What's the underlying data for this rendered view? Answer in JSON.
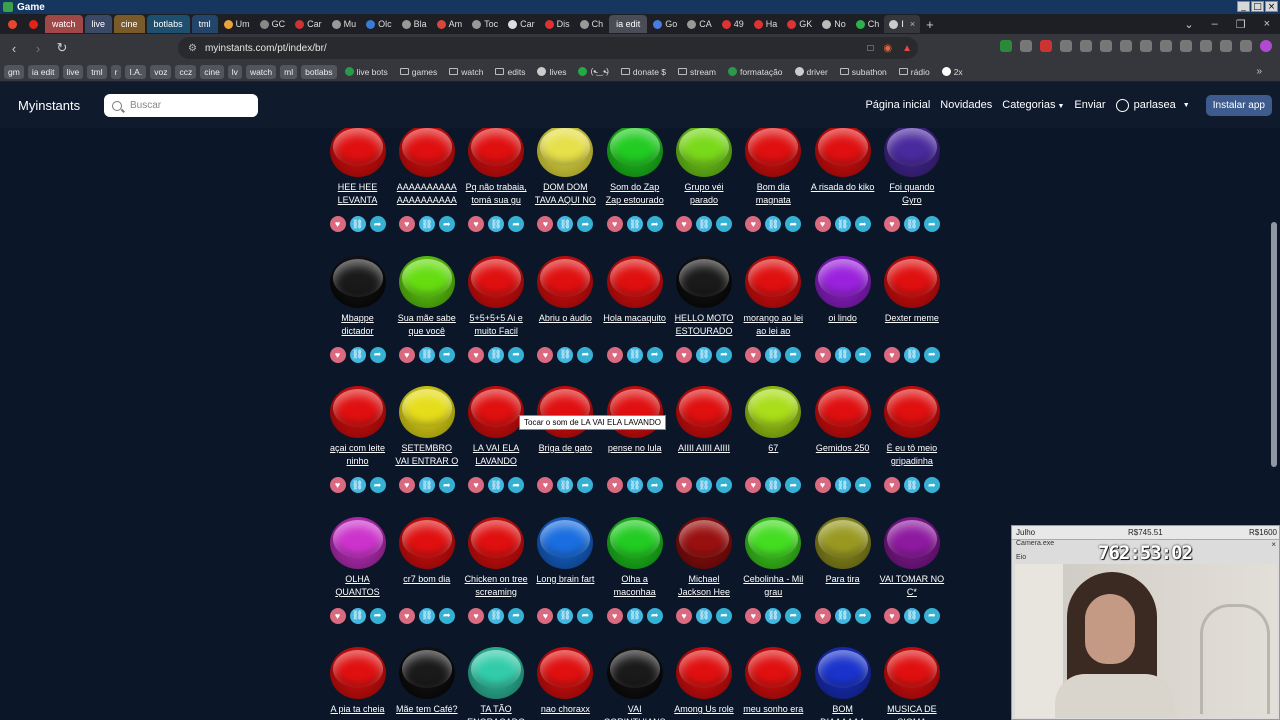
{
  "window": {
    "title": "Game"
  },
  "tabs": [
    {
      "label": "",
      "kind": "pinned",
      "color": "#e6462e"
    },
    {
      "label": "",
      "kind": "pinned",
      "color": "#e62117"
    },
    {
      "label": "watch",
      "kind": "group",
      "color": "#a04848"
    },
    {
      "label": "live",
      "kind": "group",
      "color": "#3a4a66"
    },
    {
      "label": "cine",
      "kind": "group",
      "color": "#7a5a2a"
    },
    {
      "label": "botlabs",
      "kind": "group",
      "color": "#1f4f6e"
    },
    {
      "label": "tml",
      "kind": "group",
      "color": "#24456a"
    },
    {
      "label": "Um",
      "kind": "tab",
      "color": "#e8a33c"
    },
    {
      "label": "GC",
      "kind": "tab",
      "color": "#888"
    },
    {
      "label": "Car",
      "kind": "tab",
      "color": "#c33"
    },
    {
      "label": "Mu",
      "kind": "tab",
      "color": "#999"
    },
    {
      "label": "Olc",
      "kind": "tab",
      "color": "#3a7bd5"
    },
    {
      "label": "Bla",
      "kind": "tab",
      "color": "#999"
    },
    {
      "label": "Am",
      "kind": "tab",
      "color": "#d9463b"
    },
    {
      "label": "Toc",
      "kind": "tab",
      "color": "#999"
    },
    {
      "label": "Car",
      "kind": "tab",
      "color": "#ddd"
    },
    {
      "label": "Dis",
      "kind": "tab",
      "color": "#d33"
    },
    {
      "label": "Ch",
      "kind": "tab",
      "color": "#999"
    },
    {
      "label": "ia edit",
      "kind": "group",
      "color": "#4a4d55"
    },
    {
      "label": "Go",
      "kind": "tab",
      "color": "#4a7be0"
    },
    {
      "label": "CA",
      "kind": "tab",
      "color": "#999"
    },
    {
      "label": "49",
      "kind": "tab",
      "color": "#d33"
    },
    {
      "label": "Ha",
      "kind": "tab",
      "color": "#d33"
    },
    {
      "label": "GK",
      "kind": "tab",
      "color": "#d33"
    },
    {
      "label": "No",
      "kind": "tab",
      "color": "#bbb"
    },
    {
      "label": "Ch",
      "kind": "tab",
      "color": "#2bb24c"
    },
    {
      "label": "I",
      "kind": "active",
      "color": "#ccc"
    }
  ],
  "address_bar": {
    "url": "myinstants.com/pt/index/br/"
  },
  "bookmarks": [
    {
      "label": "gm",
      "kind": "chip"
    },
    {
      "label": "ia edit",
      "kind": "chip"
    },
    {
      "label": "live",
      "kind": "chip"
    },
    {
      "label": "tml",
      "kind": "chip"
    },
    {
      "label": "r",
      "kind": "chip"
    },
    {
      "label": "I.A.",
      "kind": "chip"
    },
    {
      "label": "voz",
      "kind": "chip"
    },
    {
      "label": "ccz",
      "kind": "chip"
    },
    {
      "label": "cine",
      "kind": "chip"
    },
    {
      "label": "lv",
      "kind": "chip"
    },
    {
      "label": "watch",
      "kind": "chip"
    },
    {
      "label": "ml",
      "kind": "chip"
    },
    {
      "label": "botlabs",
      "kind": "chip"
    },
    {
      "label": "live bots",
      "kind": "fav"
    },
    {
      "label": "games",
      "kind": "folder"
    },
    {
      "label": "watch",
      "kind": "folder"
    },
    {
      "label": "edits",
      "kind": "folder"
    },
    {
      "label": "lives",
      "kind": "fav"
    },
    {
      "label": "(•̴‿•̴)",
      "kind": "fav"
    },
    {
      "label": "donate $",
      "kind": "folder"
    },
    {
      "label": "stream",
      "kind": "folder"
    },
    {
      "label": "formatação",
      "kind": "fav"
    },
    {
      "label": "driver",
      "kind": "fav"
    },
    {
      "label": "subathon",
      "kind": "folder"
    },
    {
      "label": "rádio",
      "kind": "folder"
    },
    {
      "label": "2x",
      "kind": "fav"
    }
  ],
  "site": {
    "logo": "Myinstants",
    "search_placeholder": "Buscar",
    "nav": {
      "home": "Página inicial",
      "news": "Novidades",
      "categories": "Categorias",
      "submit": "Enviar",
      "user": "parlasea",
      "install": "Instalar app"
    }
  },
  "instants": [
    {
      "label": "HEE HEE LEVANTA",
      "color": "#e01010",
      "dark": "#7a0606"
    },
    {
      "label": "AAAAAAAAAA AAAAAAAAAA",
      "color": "#e01010",
      "dark": "#7a0606"
    },
    {
      "label": "Pq não trabaia, tomá sua gu",
      "color": "#e01010",
      "dark": "#7a0606"
    },
    {
      "label": "DOM DOM TAVA AQUI NO",
      "color": "#e6e04a",
      "dark": "#8a8520"
    },
    {
      "label": "Som do Zap Zap estourado",
      "color": "#22cc22",
      "dark": "#0d6e0d"
    },
    {
      "label": "Grupo véi parado",
      "color": "#7ad91a",
      "dark": "#3d740c"
    },
    {
      "label": "Bom dia magnata",
      "color": "#e01010",
      "dark": "#7a0606"
    },
    {
      "label": "A risada do kiko",
      "color": "#e01010",
      "dark": "#7a0606"
    },
    {
      "label": "Foi quando Gyro",
      "color": "#4a2a9e",
      "dark": "#251450"
    },
    {
      "label": "Mbappe dictador",
      "color": "#1a1a1a",
      "dark": "#000000"
    },
    {
      "label": "Sua mãe sabe que você",
      "color": "#66dd11",
      "dark": "#337008"
    },
    {
      "label": "5+5+5+5 Ai e muito Facil",
      "color": "#e01010",
      "dark": "#7a0606"
    },
    {
      "label": "Abriu o áudio",
      "color": "#e01010",
      "dark": "#7a0606"
    },
    {
      "label": "Hola macaquito",
      "color": "#e01010",
      "dark": "#7a0606"
    },
    {
      "label": "HELLO MOTO ESTOURADO",
      "color": "#1a1a1a",
      "dark": "#000000"
    },
    {
      "label": "morango ao lei ao lei ao",
      "color": "#e01010",
      "dark": "#7a0606"
    },
    {
      "label": "oi lindo",
      "color": "#9a22dd",
      "dark": "#4e1070"
    },
    {
      "label": "Dexter meme",
      "color": "#e01010",
      "dark": "#7a0606"
    },
    {
      "label": "açai com leite ninho",
      "color": "#e01010",
      "dark": "#7a0606"
    },
    {
      "label": "SETEMBRO VAI ENTRAR O",
      "color": "#e6dd1a",
      "dark": "#857f0a"
    },
    {
      "label": "LA VAI ELA LAVANDO",
      "color": "#e01010",
      "dark": "#7a0606"
    },
    {
      "label": "Briga de gato",
      "color": "#e01010",
      "dark": "#7a0606"
    },
    {
      "label": "pense no lula",
      "color": "#e01010",
      "dark": "#7a0606"
    },
    {
      "label": "AIIII AIIII AIIII",
      "color": "#e01010",
      "dark": "#7a0606"
    },
    {
      "label": "67",
      "color": "#aadd1a",
      "dark": "#56700a"
    },
    {
      "label": "Gemidos 250",
      "color": "#e01010",
      "dark": "#7a0606"
    },
    {
      "label": "É eu tô meio gripadinha",
      "color": "#e01010",
      "dark": "#7a0606"
    },
    {
      "label": "OLHA QUANTOS",
      "color": "#cc33cc",
      "dark": "#661866"
    },
    {
      "label": "cr7 bom dia",
      "color": "#e01010",
      "dark": "#7a0606"
    },
    {
      "label": "Chicken on tree screaming",
      "color": "#e01010",
      "dark": "#7a0606"
    },
    {
      "label": "Long brain fart",
      "color": "#1a6ee0",
      "dark": "#0a3570"
    },
    {
      "label": "Olha a maconhaa",
      "color": "#22cc22",
      "dark": "#0d6e0d"
    },
    {
      "label": "Michael Jackson Hee",
      "color": "#991010",
      "dark": "#4a0505"
    },
    {
      "label": "Cebolinha - Mil grau",
      "color": "#44dd22",
      "dark": "#1f700f"
    },
    {
      "label": "Para tira",
      "color": "#999922",
      "dark": "#4c4c0e"
    },
    {
      "label": "VAI TOMAR NO C*",
      "color": "#8e1aa0",
      "dark": "#470d50"
    },
    {
      "label": "A pia ta cheia",
      "color": "#e01010",
      "dark": "#7a0606"
    },
    {
      "label": "Mãe tem Café?",
      "color": "#1a1a1a",
      "dark": "#000000"
    },
    {
      "label": "TA TÃO ENGRACADO",
      "color": "#33ccaa",
      "dark": "#186655"
    },
    {
      "label": "nao choraxx",
      "color": "#e01010",
      "dark": "#7a0606"
    },
    {
      "label": "VAI CORINTHIANS",
      "color": "#1a1a1a",
      "dark": "#000000"
    },
    {
      "label": "Among Us role",
      "color": "#e01010",
      "dark": "#7a0606"
    },
    {
      "label": "meu sonho era",
      "color": "#e01010",
      "dark": "#7a0606"
    },
    {
      "label": "BOM DIAAAAAA",
      "color": "#1a33cc",
      "dark": "#0d1966"
    },
    {
      "label": "MUSICA DE SIGMA",
      "color": "#e01010",
      "dark": "#7a0606"
    }
  ],
  "tooltip": "Tocar o som de LA VAI ELA LAVANDO",
  "overlay": {
    "month": "Julho",
    "goal": "R$745.51",
    "target": "R$1600",
    "app": "Camera.exe",
    "sub": "Eio",
    "timer": "762:53:02"
  }
}
